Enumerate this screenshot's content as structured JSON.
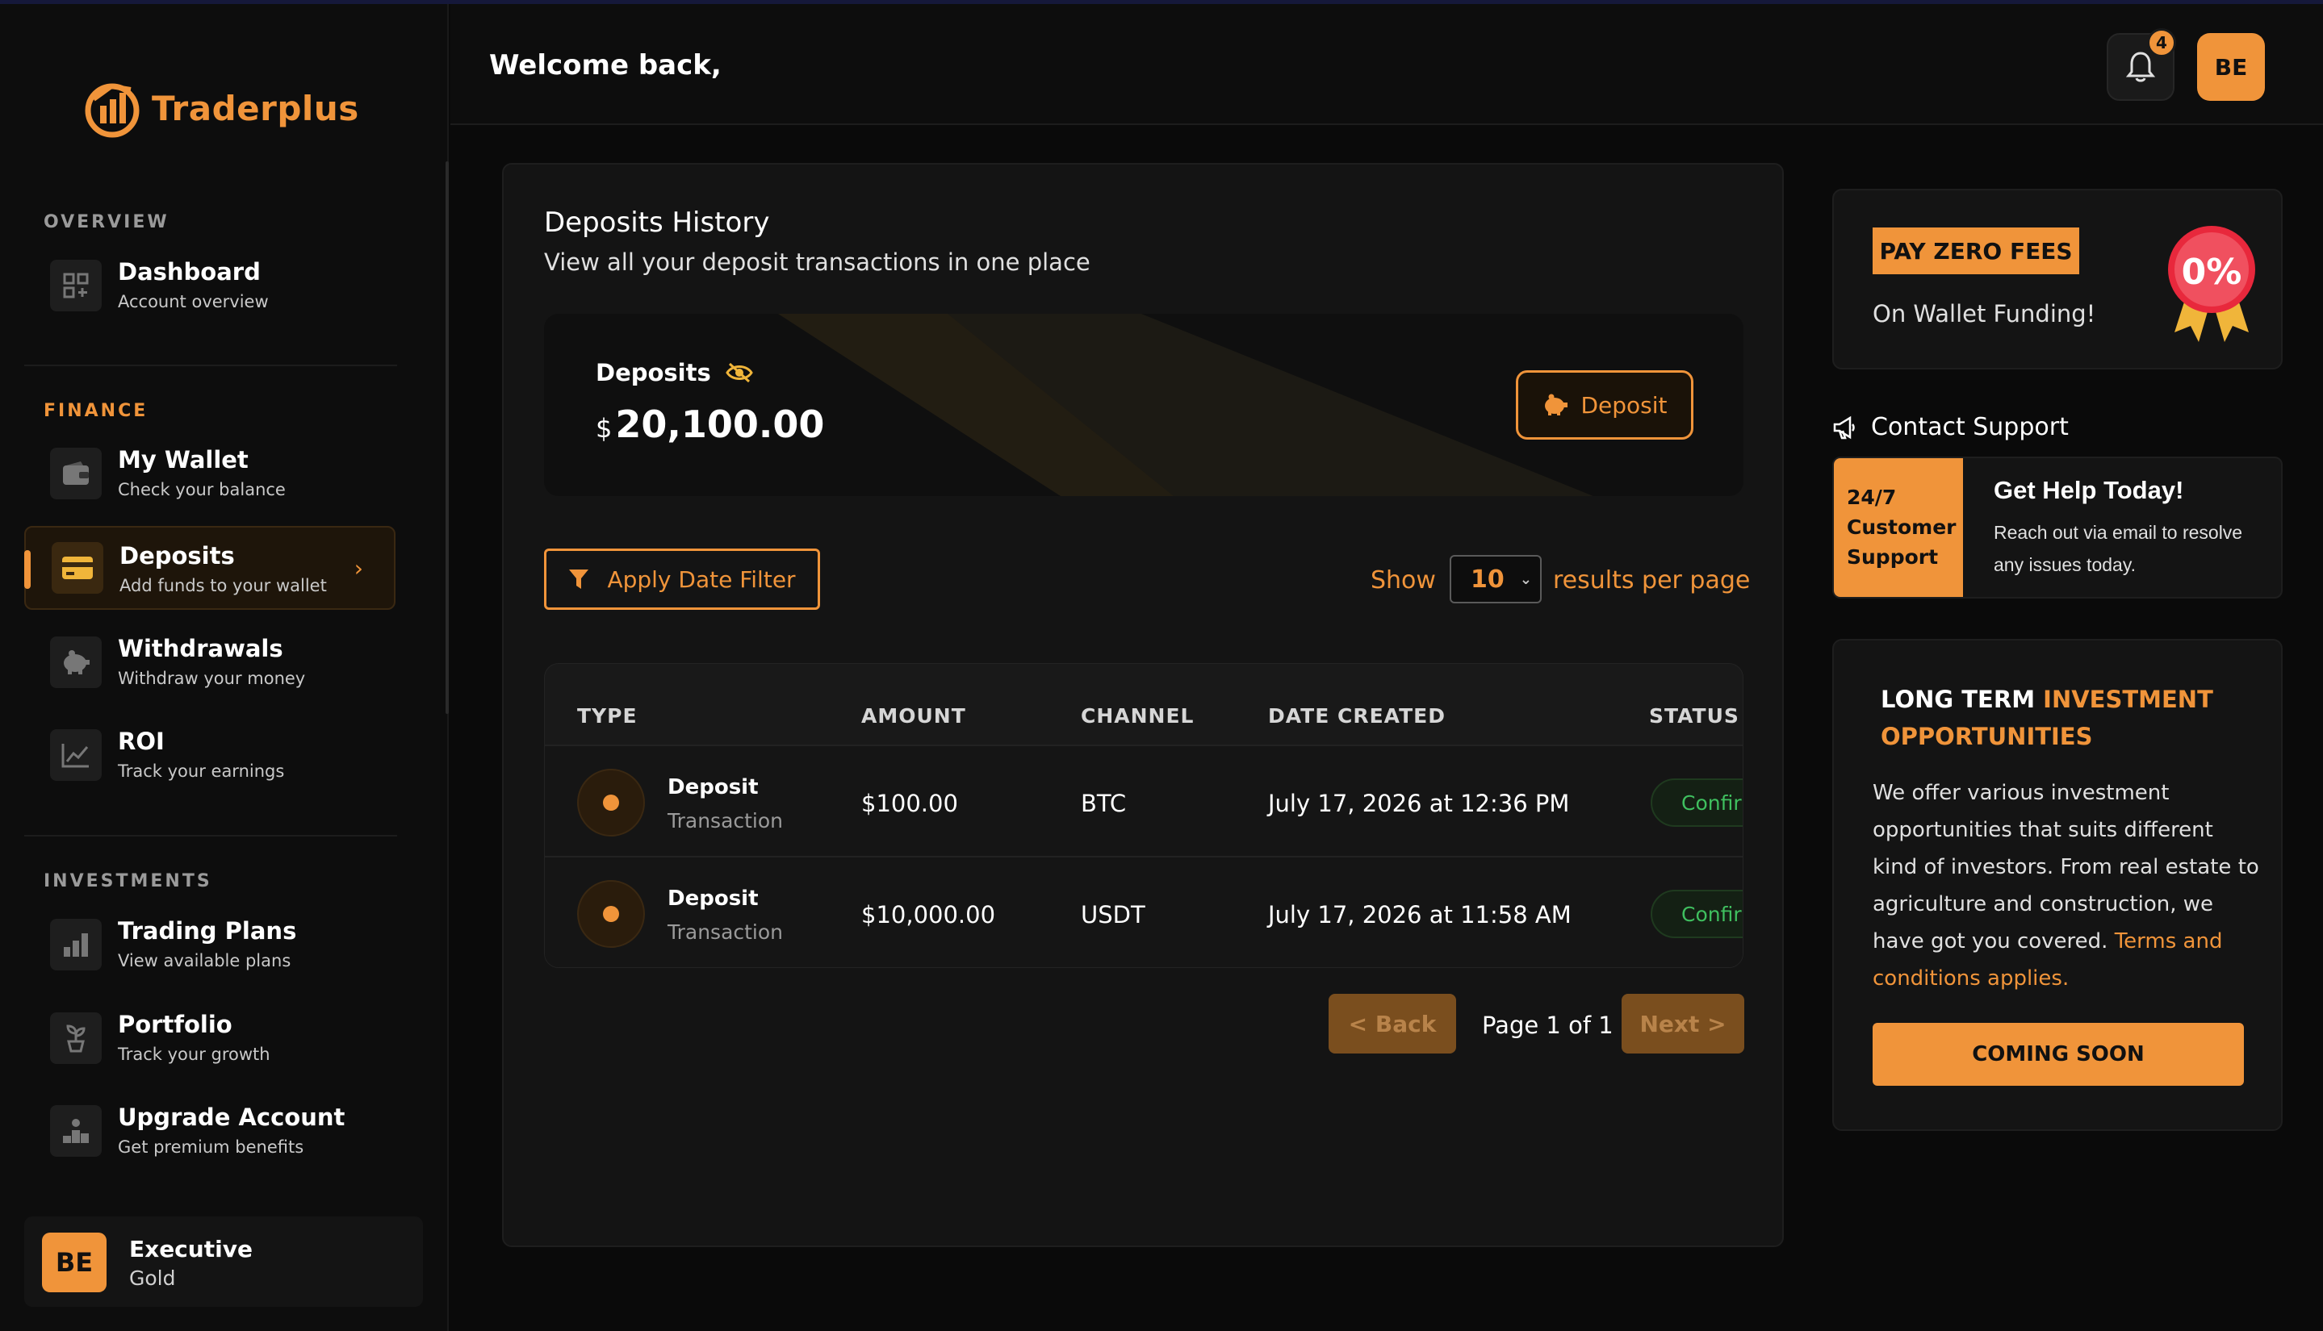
{
  "app": {
    "name": "Traderplus"
  },
  "sidebar": {
    "sections": {
      "overview": "OVERVIEW",
      "finance": "FINANCE",
      "investments": "INVESTMENTS"
    },
    "items": [
      {
        "label": "Dashboard",
        "sub": "Account overview",
        "icon": "dashboard-icon"
      },
      {
        "label": "My Wallet",
        "sub": "Check your balance",
        "icon": "wallet-icon"
      },
      {
        "label": "Deposits",
        "sub": "Add funds to your wallet",
        "icon": "card-icon",
        "active": true
      },
      {
        "label": "Withdrawals",
        "sub": "Withdraw your money",
        "icon": "piggy-bank-icon"
      },
      {
        "label": "ROI",
        "sub": "Track your earnings",
        "icon": "chart-line-icon"
      },
      {
        "label": "Trading Plans",
        "sub": "View available plans",
        "icon": "bar-chart-icon"
      },
      {
        "label": "Portfolio",
        "sub": "Track your growth",
        "icon": "plant-icon"
      },
      {
        "label": "Upgrade Account",
        "sub": "Get premium benefits",
        "icon": "podium-icon"
      }
    ],
    "user": {
      "initials": "BE",
      "name": "Executive",
      "tier": "Gold"
    }
  },
  "header": {
    "welcome": "Welcome back,",
    "notification_count": "4",
    "avatar_initials": "BE"
  },
  "deposits": {
    "title": "Deposits History",
    "subtitle": "View all your deposit transactions in one place",
    "balance_label": "Deposits",
    "currency": "$",
    "balance": "20,100.00",
    "deposit_button": "Deposit",
    "filter_button": "Apply Date Filter",
    "show_label": "Show",
    "per_page": "10",
    "results_label": "results per page"
  },
  "table": {
    "headers": {
      "type": "TYPE",
      "amount": "AMOUNT",
      "channel": "CHANNEL",
      "date": "DATE CREATED",
      "status": "STATUS"
    },
    "rows": [
      {
        "type": "Deposit",
        "type_sub": "Transaction",
        "amount": "$100.00",
        "channel": "BTC",
        "date": "July 17, 2026 at 12:36 PM",
        "status": "Confirmed"
      },
      {
        "type": "Deposit",
        "type_sub": "Transaction",
        "amount": "$10,000.00",
        "channel": "USDT",
        "date": "July 17, 2026 at 11:58 AM",
        "status": "Confirmed"
      }
    ]
  },
  "pagination": {
    "back": "< Back",
    "info": "Page 1 of 1",
    "next": "Next >"
  },
  "promo": {
    "tag": "PAY ZERO FEES",
    "sub": "On Wallet Funding!",
    "badge": "0%"
  },
  "support": {
    "title": "Contact Support",
    "left": [
      "24/7",
      "Customer",
      "Support"
    ],
    "heading": "Get Help Today!",
    "text": "Reach out via email to resolve any issues today."
  },
  "investment": {
    "heading_white": "LONG TERM ",
    "heading_orange": "INVESTMENT OPPORTUNITIES",
    "text": "We offer various investment opportunities that suits different kind of investors. From real estate to agriculture and construction, we have got you covered. ",
    "link": "Terms and conditions applies.",
    "button": "COMING SOON"
  },
  "colors": {
    "accent": "#f0943a",
    "background": "#0a0a0a",
    "card": "#141414",
    "success": "#3fbf5f"
  }
}
